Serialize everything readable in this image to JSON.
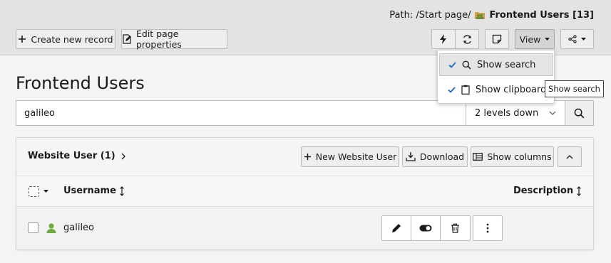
{
  "header": {
    "path_label": "Path: /Start page/",
    "page_name": "Frontend Users [13]",
    "create_record_label": "Create new record",
    "edit_page_label": "Edit page properties",
    "view_label": "View"
  },
  "main": {
    "title": "Frontend Users",
    "search": {
      "value": "galileo",
      "levels": "2 levels down"
    }
  },
  "dropdown": {
    "items": [
      {
        "label": "Show search",
        "checked": true
      },
      {
        "label": "Show clipboard",
        "checked": true
      }
    ],
    "tooltip": "Show search"
  },
  "panel": {
    "title": "Website User (1)",
    "new_label": "New Website User",
    "download_label": "Download",
    "columns_label": "Show columns",
    "headers": {
      "username": "Username",
      "description": "Description"
    },
    "rows": [
      {
        "username": "galileo"
      }
    ]
  },
  "colors": {
    "check": "#1b66c9",
    "user_icon": "#6daa3b"
  }
}
